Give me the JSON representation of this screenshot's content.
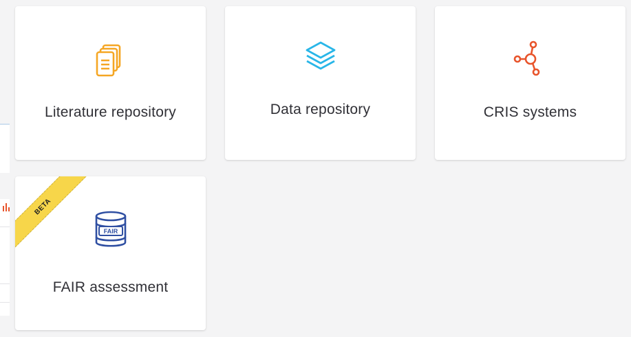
{
  "cards": [
    {
      "label": "Literature repository",
      "icon": "documents-icon",
      "color": "#f5a623"
    },
    {
      "label": "Data repository",
      "icon": "layers-icon",
      "color": "#29b6e8"
    },
    {
      "label": "CRIS systems",
      "icon": "network-nodes-icon",
      "color": "#e8542b"
    },
    {
      "label": "FAIR assessment",
      "icon": "fair-database-icon",
      "color": "#2f4fa2",
      "badge": "BETA",
      "icon_text": "FAIR"
    }
  ],
  "colors": {
    "beta_ribbon": "#f7d64a",
    "card_bg": "#ffffff",
    "page_bg": "#f4f4f5"
  }
}
